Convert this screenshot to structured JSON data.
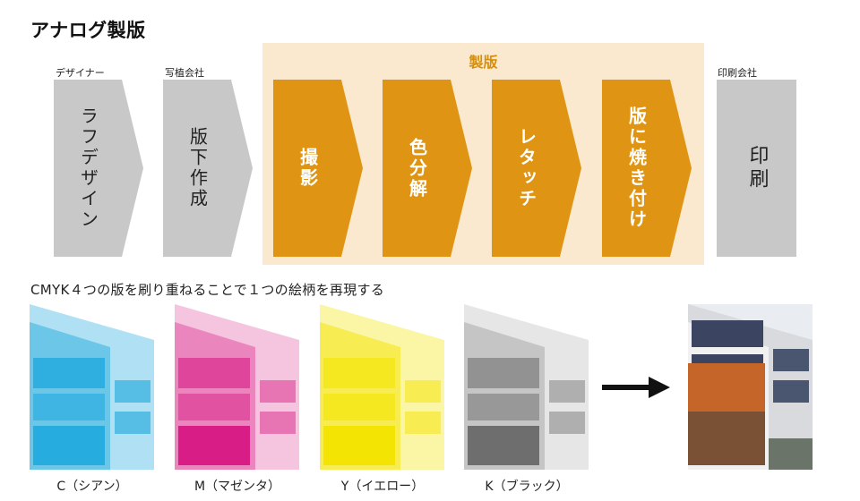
{
  "title": "アナログ製版",
  "group_label": "製版",
  "actors": {
    "designer": "デザイナー",
    "plate_maker": "写植会社",
    "printer": "印刷会社"
  },
  "steps": [
    {
      "label": "ラフデザイン"
    },
    {
      "label": "版下作成"
    },
    {
      "label": "撮影"
    },
    {
      "label": "色分解"
    },
    {
      "label": "レタッチ"
    },
    {
      "label": "版に焼き付け"
    },
    {
      "label": "印刷"
    }
  ],
  "subtitle": "CMYK４つの版を刷り重ねることで１つの絵柄を再現する",
  "plates": [
    {
      "caption": "C（シアン）",
      "color": "#1aa7dc"
    },
    {
      "caption": "M（マゼンタ）",
      "color": "#d6137f"
    },
    {
      "caption": "Y（イエロー）",
      "color": "#f3e400"
    },
    {
      "caption": "K（ブラック）",
      "color": "#333333"
    }
  ],
  "colors": {
    "orange": "#df9513",
    "group_bg": "#fbe9cf",
    "gray": "#c8c8c8",
    "group_label": "#d68f0d"
  }
}
